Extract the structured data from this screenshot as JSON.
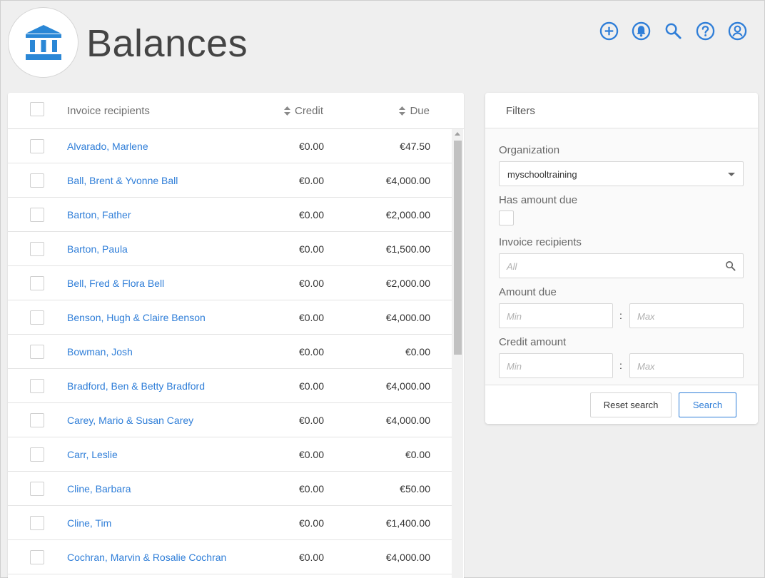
{
  "header": {
    "title": "Balances"
  },
  "top_icons": [
    "add-circle-icon",
    "bell-icon",
    "search-icon",
    "help-icon",
    "account-icon"
  ],
  "colors": {
    "accent": "#2f7ed8",
    "logo": "#2a87d6"
  },
  "table": {
    "columns": {
      "name": "Invoice recipients",
      "credit": "Credit",
      "due": "Due"
    },
    "rows": [
      {
        "name": "Alvarado, Marlene",
        "credit": "€0.00",
        "due": "€47.50"
      },
      {
        "name": "Ball, Brent & Yvonne Ball",
        "credit": "€0.00",
        "due": "€4,000.00"
      },
      {
        "name": "Barton, Father",
        "credit": "€0.00",
        "due": "€2,000.00"
      },
      {
        "name": "Barton, Paula",
        "credit": "€0.00",
        "due": "€1,500.00"
      },
      {
        "name": "Bell, Fred & Flora Bell",
        "credit": "€0.00",
        "due": "€2,000.00"
      },
      {
        "name": "Benson, Hugh & Claire Benson",
        "credit": "€0.00",
        "due": "€4,000.00"
      },
      {
        "name": "Bowman, Josh",
        "credit": "€0.00",
        "due": "€0.00"
      },
      {
        "name": "Bradford, Ben & Betty Bradford",
        "credit": "€0.00",
        "due": "€4,000.00"
      },
      {
        "name": "Carey, Mario & Susan Carey",
        "credit": "€0.00",
        "due": "€4,000.00"
      },
      {
        "name": "Carr, Leslie",
        "credit": "€0.00",
        "due": "€0.00"
      },
      {
        "name": "Cline, Barbara",
        "credit": "€0.00",
        "due": "€50.00"
      },
      {
        "name": "Cline, Tim",
        "credit": "€0.00",
        "due": "€1,400.00"
      },
      {
        "name": "Cochran, Marvin & Rosalie Cochran",
        "credit": "€0.00",
        "due": "€4,000.00"
      }
    ]
  },
  "filters": {
    "title": "Filters",
    "organization": {
      "label": "Organization",
      "value": "myschooltraining"
    },
    "has_amount_due": {
      "label": "Has amount due"
    },
    "invoice_recipients": {
      "label": "Invoice recipients",
      "placeholder": "All"
    },
    "amount_due": {
      "label": "Amount due",
      "min_placeholder": "Min",
      "max_placeholder": "Max",
      "separator": ":"
    },
    "credit_amount": {
      "label": "Credit amount",
      "min_placeholder": "Min",
      "max_placeholder": "Max",
      "separator": ":"
    },
    "reset_label": "Reset search",
    "search_label": "Search"
  }
}
